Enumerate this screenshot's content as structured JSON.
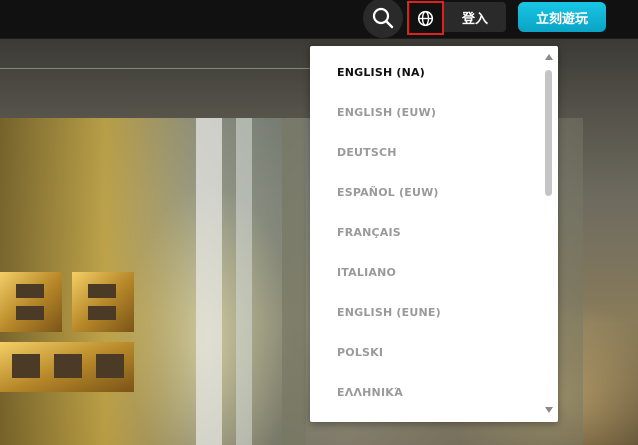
{
  "header": {
    "search_icon": "search-icon",
    "globe_icon": "globe-icon",
    "login_label": "登入",
    "play_label": "立刻遊玩",
    "accent_color": "#0bc4e2",
    "highlight_color": "#e0201c"
  },
  "language_menu": {
    "items": [
      {
        "label": "ENGLISH (NA)",
        "selected": true
      },
      {
        "label": "ENGLISH (EUW)",
        "selected": false
      },
      {
        "label": "DEUTSCH",
        "selected": false
      },
      {
        "label": "ESPAÑOL (EUW)",
        "selected": false
      },
      {
        "label": "FRANÇAIS",
        "selected": false
      },
      {
        "label": "ITALIANO",
        "selected": false
      },
      {
        "label": "ENGLISH (EUNE)",
        "selected": false
      },
      {
        "label": "POLSKI",
        "selected": false
      },
      {
        "label": "ΕΛΛΗΝΙΚΆ",
        "selected": false
      }
    ]
  }
}
